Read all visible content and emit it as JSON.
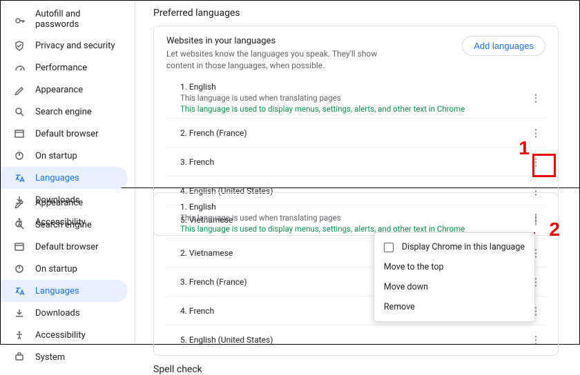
{
  "sections": {
    "preferred_heading": "Preferred languages",
    "spellcheck_heading": "Spell check"
  },
  "card": {
    "title": "Websites in your languages",
    "subtitle": "Let websites know the languages you speak. They'll show content in those languages, when possible.",
    "add_btn": "Add languages",
    "translate_desc": "This language is used when translating pages",
    "ui_desc": "This language is used to display menus, settings, alerts, and other text in Chrome"
  },
  "sidebar_top": [
    {
      "label": "Autofill and passwords",
      "icon": "key"
    },
    {
      "label": "Privacy and security",
      "icon": "shield"
    },
    {
      "label": "Performance",
      "icon": "speed"
    },
    {
      "label": "Appearance",
      "icon": "pen"
    },
    {
      "label": "Search engine",
      "icon": "search"
    },
    {
      "label": "Default browser",
      "icon": "browser"
    },
    {
      "label": "On startup",
      "icon": "power"
    },
    {
      "label": "Languages",
      "icon": "translate",
      "active": true
    },
    {
      "label": "Downloads",
      "icon": "download"
    },
    {
      "label": "Accessibility",
      "icon": "a11y"
    }
  ],
  "sidebar_bottom": [
    {
      "label": "Appearance",
      "icon": "pen"
    },
    {
      "label": "Search engine",
      "icon": "search"
    },
    {
      "label": "Default browser",
      "icon": "browser"
    },
    {
      "label": "On startup",
      "icon": "power"
    },
    {
      "label": "Languages",
      "icon": "translate",
      "active": true
    },
    {
      "label": "Downloads",
      "icon": "download"
    },
    {
      "label": "Accessibility",
      "icon": "a11y"
    },
    {
      "label": "System",
      "icon": "system"
    }
  ],
  "langs_top": [
    {
      "n": "1.",
      "name": "English",
      "translate": true,
      "ui": true
    },
    {
      "n": "2.",
      "name": "French (France)"
    },
    {
      "n": "3.",
      "name": "French"
    },
    {
      "n": "4.",
      "name": "English (United States)"
    },
    {
      "n": "5.",
      "name": "Vietnamese"
    }
  ],
  "langs_bottom": [
    {
      "n": "1.",
      "name": "English",
      "translate": true,
      "ui": true
    },
    {
      "n": "2.",
      "name": "Vietnamese"
    },
    {
      "n": "3.",
      "name": "French (France)"
    },
    {
      "n": "4.",
      "name": "French"
    },
    {
      "n": "5.",
      "name": "English (United States)"
    }
  ],
  "menu": {
    "display": "Display Chrome in this language",
    "top": "Move to the top",
    "down": "Move down",
    "remove": "Remove"
  },
  "annot": {
    "one": "1",
    "two": "2"
  }
}
